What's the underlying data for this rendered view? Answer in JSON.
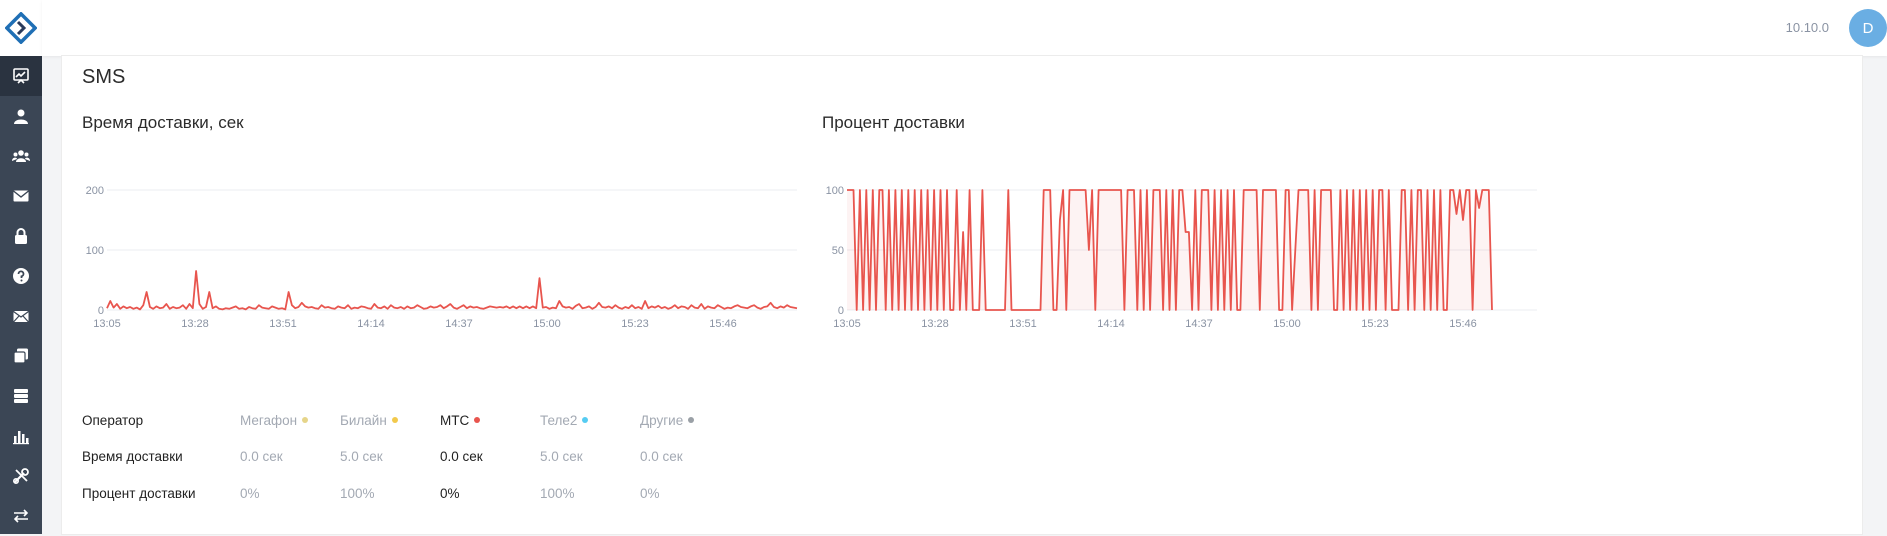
{
  "header": {
    "version": "10.10.0",
    "avatar_letter": "D"
  },
  "sidebar": {
    "items": [
      {
        "icon": "monitoring-chart-icon",
        "active": true
      },
      {
        "icon": "user-icon",
        "active": false
      },
      {
        "icon": "users-group-icon",
        "active": false
      },
      {
        "icon": "envelope-icon",
        "active": false
      },
      {
        "icon": "lock-icon",
        "active": false
      },
      {
        "icon": "help-circle-icon",
        "active": false
      },
      {
        "icon": "envelope-open-icon",
        "active": false
      },
      {
        "icon": "copy-stack-icon",
        "active": false
      },
      {
        "icon": "database-icon",
        "active": false
      },
      {
        "icon": "bar-chart-icon",
        "active": false
      },
      {
        "icon": "tools-icon",
        "active": false
      },
      {
        "icon": "transfer-arrows-icon",
        "active": false
      }
    ]
  },
  "page": {
    "section_title": "SMS"
  },
  "chart_data": [
    {
      "type": "line",
      "title": "Время доставки, сек",
      "ylim": [
        0,
        200
      ],
      "yticks": [
        "200",
        "100",
        "0"
      ],
      "xticks": [
        "13:05",
        "13:28",
        "13:51",
        "14:14",
        "14:37",
        "15:00",
        "15:23",
        "15:46"
      ],
      "color": "#e8554e",
      "fill": false,
      "grid": true,
      "values": [
        3,
        15,
        4,
        10,
        2,
        6,
        3,
        5,
        2,
        4,
        1,
        8,
        30,
        5,
        2,
        6,
        3,
        4,
        10,
        2,
        5,
        3,
        4,
        8,
        2,
        10,
        3,
        65,
        10,
        2,
        5,
        30,
        3,
        6,
        2,
        1,
        3,
        2,
        4,
        6,
        2,
        3,
        1,
        5,
        3,
        2,
        8,
        4,
        3,
        2,
        6,
        4,
        2,
        3,
        1,
        30,
        8,
        3,
        5,
        12,
        6,
        4,
        5,
        3,
        2,
        8,
        4,
        5,
        3,
        2,
        6,
        4,
        3,
        8,
        2,
        4,
        3,
        6,
        5,
        3,
        2,
        10,
        4,
        3,
        6,
        2,
        8,
        4,
        3,
        5,
        2,
        6,
        3,
        4,
        8,
        5,
        2,
        3,
        6,
        4,
        5,
        8,
        3,
        6,
        10,
        4,
        2,
        5,
        8,
        3,
        6,
        4,
        5,
        3,
        2,
        4,
        6,
        5,
        4,
        5,
        4,
        6,
        3,
        6,
        3,
        6,
        3,
        6,
        3,
        6,
        3,
        53,
        4,
        5,
        2,
        4,
        3,
        15,
        6,
        4,
        5,
        2,
        7,
        10,
        3,
        4,
        6,
        2,
        5,
        12,
        5,
        4,
        6,
        3,
        8,
        4,
        2,
        5,
        3,
        8,
        3,
        5,
        2,
        15,
        3,
        6,
        4,
        7,
        3,
        5,
        2,
        4,
        8,
        3,
        6,
        5,
        2,
        8,
        4,
        3,
        10,
        2,
        6,
        4,
        3,
        8,
        5,
        2,
        4,
        3,
        6,
        8,
        5,
        4,
        3,
        6,
        8,
        4,
        2,
        5,
        6,
        12,
        5,
        3,
        6,
        4,
        8,
        5,
        4,
        3
      ]
    },
    {
      "type": "line",
      "title": "Процент доставки",
      "ylim": [
        0,
        100
      ],
      "yticks": [
        "100",
        "50",
        "0"
      ],
      "xticks": [
        "13:05",
        "13:28",
        "13:51",
        "14:14",
        "14:37",
        "15:00",
        "15:23",
        "15:46"
      ],
      "color": "#e8554e",
      "fill": true,
      "grid": true,
      "values": [
        100,
        100,
        100,
        0,
        100,
        0,
        100,
        0,
        100,
        0,
        100,
        100,
        0,
        100,
        0,
        100,
        0,
        100,
        0,
        100,
        0,
        100,
        0,
        100,
        0,
        100,
        0,
        100,
        0,
        100,
        0,
        100,
        0,
        0,
        100,
        0,
        65,
        0,
        100,
        0,
        0,
        0,
        100,
        0,
        0,
        0,
        0,
        0,
        0,
        0,
        100,
        0,
        0,
        0,
        0,
        0,
        0,
        0,
        0,
        0,
        0,
        100,
        100,
        100,
        0,
        0,
        75,
        100,
        0,
        100,
        100,
        100,
        100,
        100,
        100,
        50,
        100,
        0,
        100,
        100,
        100,
        100,
        100,
        100,
        100,
        100,
        0,
        100,
        100,
        100,
        0,
        100,
        0,
        100,
        0,
        100,
        100,
        100,
        0,
        100,
        0,
        100,
        0,
        100,
        100,
        65,
        65,
        0,
        100,
        0,
        100,
        100,
        100,
        0,
        100,
        0,
        100,
        0,
        100,
        0,
        100,
        0,
        0,
        100,
        100,
        100,
        100,
        100,
        0,
        100,
        100,
        100,
        100,
        100,
        0,
        0,
        100,
        100,
        0,
        50,
        100,
        100,
        100,
        100,
        0,
        100,
        0,
        100,
        100,
        100,
        100,
        0,
        0,
        100,
        0,
        100,
        0,
        100,
        0,
        100,
        0,
        100,
        0,
        100,
        0,
        100,
        100,
        0,
        100,
        0,
        0,
        0,
        100,
        100,
        0,
        100,
        0,
        100,
        100,
        0,
        100,
        0,
        100,
        0,
        100,
        0,
        0,
        100,
        100,
        80,
        100,
        75,
        100,
        100,
        0,
        100,
        85,
        100,
        100,
        100,
        0
      ]
    }
  ],
  "operators": {
    "header_label": "Оператор",
    "row1_label": "Время доставки",
    "row2_label": "Процент доставки",
    "items": [
      {
        "name": "Мегафон",
        "dot_color": "#e6d58a",
        "time": "0.0 сек",
        "percent": "0%",
        "active": false
      },
      {
        "name": "Билайн",
        "dot_color": "#f2c94c",
        "time": "5.0 сек",
        "percent": "100%",
        "active": false
      },
      {
        "name": "МТС",
        "dot_color": "#e8554e",
        "time": "0.0 сек",
        "percent": "0%",
        "active": true
      },
      {
        "name": "Теле2",
        "dot_color": "#56ccf2",
        "time": "5.0 сек",
        "percent": "100%",
        "active": false
      },
      {
        "name": "Другие",
        "dot_color": "#9aa0a6",
        "time": "0.0 сек",
        "percent": "0%",
        "active": false
      }
    ]
  }
}
